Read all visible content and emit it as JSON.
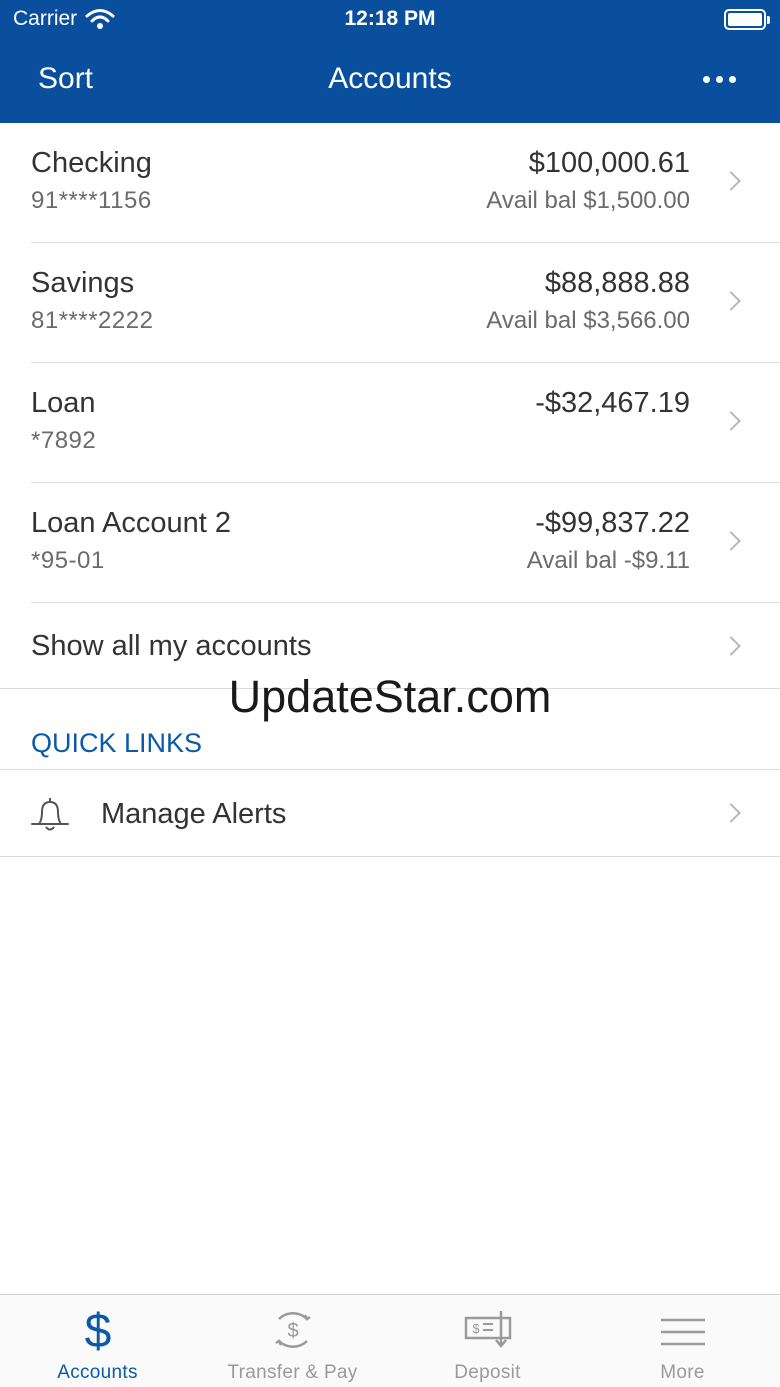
{
  "status_bar": {
    "carrier": "Carrier",
    "time": "12:18 PM"
  },
  "nav": {
    "left": "Sort",
    "title": "Accounts",
    "more_icon": "ellipsis-icon"
  },
  "accounts": [
    {
      "name": "Checking",
      "number": "91****1156",
      "balance": "$100,000.61",
      "avail": "Avail bal $1,500.00"
    },
    {
      "name": "Savings",
      "number": "81****2222",
      "balance": "$88,888.88",
      "avail": "Avail bal $3,566.00"
    },
    {
      "name": "Loan",
      "number": "*7892",
      "balance": "-$32,467.19",
      "avail": ""
    },
    {
      "name": "Loan Account 2",
      "number": "*95-01",
      "balance": "-$99,837.22",
      "avail": "Avail bal -$9.11"
    }
  ],
  "show_all": "Show all my accounts",
  "watermark": "UpdateStar.com",
  "quick_links": {
    "heading": "QUICK LINKS",
    "items": [
      {
        "label": "Manage Alerts",
        "icon": "bell-icon"
      }
    ]
  },
  "tabs": [
    {
      "label": "Accounts",
      "icon": "dollar-icon",
      "active": true
    },
    {
      "label": "Transfer & Pay",
      "icon": "transfer-icon",
      "active": false
    },
    {
      "label": "Deposit",
      "icon": "check-deposit-icon",
      "active": false
    },
    {
      "label": "More",
      "icon": "menu-icon",
      "active": false
    }
  ],
  "colors": {
    "brand": "#0a4f9e",
    "accent": "#0a5aa8",
    "inactive": "#9a9a9a"
  }
}
